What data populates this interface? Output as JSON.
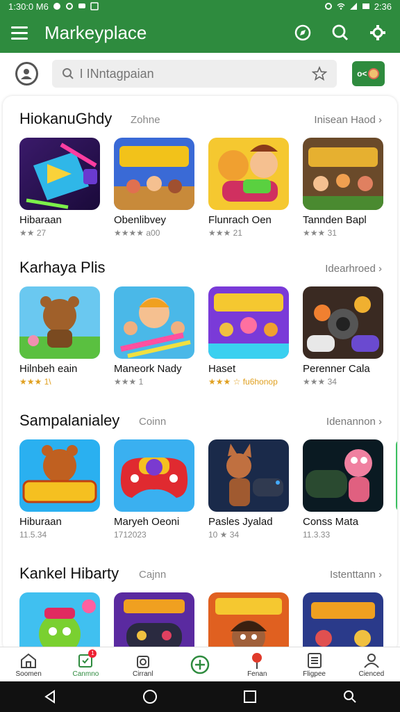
{
  "status_bar": {
    "time": "1:30:0 M6",
    "right_time": "2:36"
  },
  "app_bar": {
    "title": "Markeyplace"
  },
  "search": {
    "placeholder": "I INntagpaian"
  },
  "cart": {
    "label": "o<"
  },
  "sections": [
    {
      "title": "HiokanuGhdy",
      "subtitle": "Zohne",
      "link": "Inisean Haod",
      "apps": [
        {
          "name": "Hibaraan",
          "meta": "★★ 27",
          "icon": "play-store-icon"
        },
        {
          "name": "Obenlibvey",
          "meta": "★★★★ a00",
          "icon": "himarar-game-icon"
        },
        {
          "name": "Flunrach Oen",
          "meta": "★★★ 21",
          "icon": "cat-characters-icon"
        },
        {
          "name": "Tannden Bapl",
          "meta": "★★★ 31",
          "icon": "runnaan-game-icon"
        }
      ]
    },
    {
      "title": "Karhaya Plis",
      "subtitle": "",
      "link": "Idearhroed",
      "apps": [
        {
          "name": "Hilnbeh eain",
          "meta": "★★★ 1\\",
          "icon": "bear-character-icon"
        },
        {
          "name": "Maneork Nady",
          "meta": "★★★ 1",
          "icon": "kids-game-icon"
        },
        {
          "name": "Haset",
          "meta": "★★★ ☆ fu6honop",
          "icon": "himuras-game-icon"
        },
        {
          "name": "Perenner Cala",
          "meta": "★★★ 34",
          "icon": "gamepad-characters-icon"
        }
      ]
    },
    {
      "title": "Sampalanialey",
      "subtitle": "Coinn",
      "link": "Idenannon",
      "apps": [
        {
          "name": "Hiburaan",
          "meta": "11.5.34",
          "icon": "sipuras-game-icon"
        },
        {
          "name": "Maryeh Oeoni",
          "meta": "1712023",
          "icon": "gamepad-face-icon"
        },
        {
          "name": "Pasles Jyalad",
          "meta": "10 ★ 34",
          "icon": "fox-character-icon"
        },
        {
          "name": "Conss Mata",
          "meta": "11.3.33",
          "icon": "pink-character-icon"
        }
      ]
    },
    {
      "title": "Kankel Hibarty",
      "subtitle": "Cajnn",
      "link": "Istenttann",
      "apps": [
        {
          "name": "",
          "meta": "",
          "icon": "green-monster-icon"
        },
        {
          "name": "",
          "meta": "",
          "icon": "controller-game-icon"
        },
        {
          "name": "",
          "meta": "",
          "icon": "hero-character-icon"
        },
        {
          "name": "",
          "meta": "",
          "icon": "nieras-game-icon"
        }
      ]
    }
  ],
  "bottom_nav": [
    {
      "label": "Soomen",
      "icon": "home-icon"
    },
    {
      "label": "Canmno",
      "icon": "store-icon",
      "badge": "1"
    },
    {
      "label": "Cirranl",
      "icon": "bag-icon"
    },
    {
      "label": "",
      "icon": "add-icon"
    },
    {
      "label": "Fenan",
      "icon": "pin-icon"
    },
    {
      "label": "Fligpee",
      "icon": "list-icon"
    },
    {
      "label": "Cienced",
      "icon": "profile-icon"
    }
  ],
  "colors": {
    "brand": "#2e8b3e",
    "stars": "#e0a020"
  }
}
